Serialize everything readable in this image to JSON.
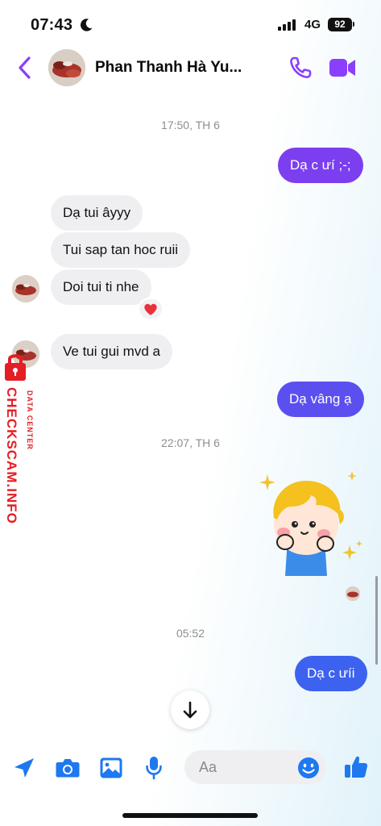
{
  "status_bar": {
    "time": "07:43",
    "network": "4G",
    "battery": "92"
  },
  "header": {
    "contact_name": "Phan Thanh Hà Yu...",
    "accent_color": "#8a3ffc"
  },
  "messages": {
    "timestamp_1": "17:50, TH 6",
    "out_1": "Dạ c ưí ;-;",
    "in_1": "Dạ tui âyyy",
    "in_2": "Tui sap tan hoc ruii",
    "in_3": "Doi tui ti nhe",
    "in_3_reaction": "❤️",
    "in_4": "Ve tui gui mvd a",
    "out_2": "Dạ vâng ạ",
    "timestamp_2": "22:07, TH 6",
    "sticker": "boy-sticker",
    "timestamp_3": "05:52",
    "out_3": "Dạ c ưíi"
  },
  "watermark": {
    "brand": "CHECKSCAM.INFO",
    "sub": "DATA CENTER",
    "color": "#e31e24"
  },
  "composer": {
    "placeholder": "Aa",
    "icon_color": "#1e78f0"
  },
  "bubble_colors": {
    "outgoing_top": "#7b3fef",
    "outgoing_mid": "#5b4ff0",
    "outgoing_bottom": "#3d62f0",
    "incoming": "#efeff1"
  }
}
